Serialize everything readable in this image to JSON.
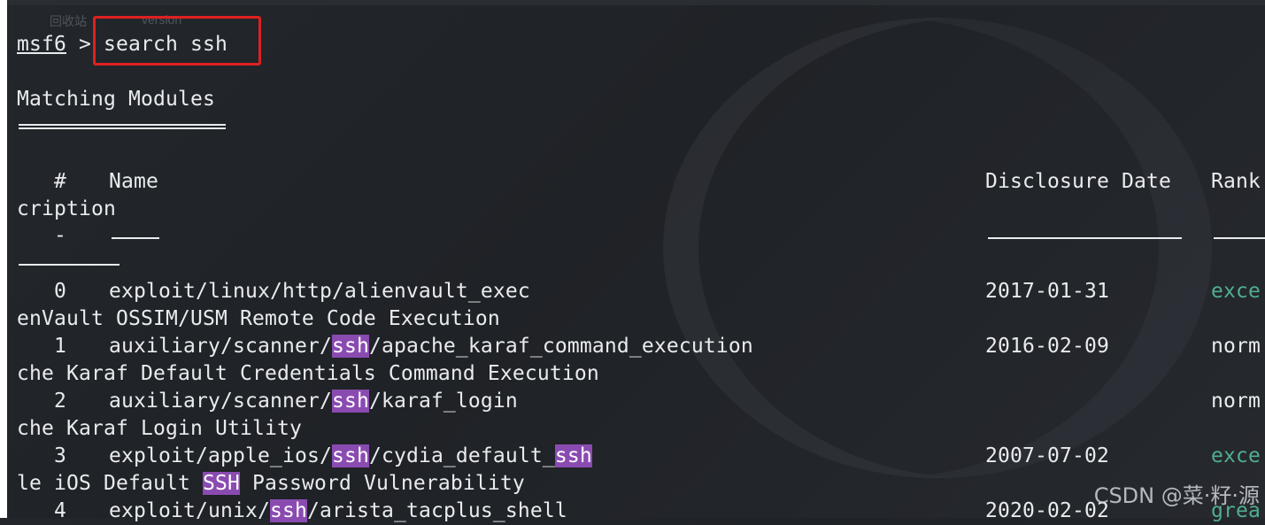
{
  "terminal": {
    "prompt": "msf6",
    "arrow": " > ",
    "command": "search ssh",
    "heading": "Matching Modules",
    "faded_top_left": "回收站",
    "faded_top_mid": "version"
  },
  "table": {
    "header_num": "   #   ",
    "header_name": "Name",
    "header_date": "Disclosure Date",
    "header_rank": "Rank",
    "header_desc_tail": "cription",
    "dash_num": "   -",
    "rows": [
      {
        "num": "   0   ",
        "name_parts": [
          {
            "t": "exploit/linux/http/alienvault_exec",
            "h": false
          }
        ],
        "date": "2017-01-31",
        "rank": "exce",
        "rank_green": true,
        "desc_parts": [
          {
            "t": "enVault OSSIM/USM Remote Code Execution",
            "h": false
          }
        ]
      },
      {
        "num": "   1   ",
        "name_parts": [
          {
            "t": "auxiliary/scanner/",
            "h": false
          },
          {
            "t": "ssh",
            "h": true
          },
          {
            "t": "/apache_karaf_command_execution",
            "h": false
          }
        ],
        "date": "2016-02-09",
        "rank": "norm",
        "rank_green": false,
        "desc_parts": [
          {
            "t": "che Karaf Default Credentials Command Execution",
            "h": false
          }
        ]
      },
      {
        "num": "   2   ",
        "name_parts": [
          {
            "t": "auxiliary/scanner/",
            "h": false
          },
          {
            "t": "ssh",
            "h": true
          },
          {
            "t": "/karaf_login",
            "h": false
          }
        ],
        "date": "",
        "rank": "norm",
        "rank_green": false,
        "desc_parts": [
          {
            "t": "che Karaf Login Utility",
            "h": false
          }
        ]
      },
      {
        "num": "   3   ",
        "name_parts": [
          {
            "t": "exploit/apple_ios/",
            "h": false
          },
          {
            "t": "ssh",
            "h": true
          },
          {
            "t": "/cydia_default_",
            "h": false
          },
          {
            "t": "ssh",
            "h": true
          }
        ],
        "date": "2007-07-02",
        "rank": "exce",
        "rank_green": true,
        "desc_parts": [
          {
            "t": "le iOS Default ",
            "h": false
          },
          {
            "t": "SSH",
            "h": true
          },
          {
            "t": " Password Vulnerability",
            "h": false
          }
        ]
      },
      {
        "num": "   4   ",
        "name_parts": [
          {
            "t": "exploit/unix/",
            "h": false
          },
          {
            "t": "ssh",
            "h": true
          },
          {
            "t": "/arista_tacplus_shell",
            "h": false
          }
        ],
        "date": "2020-02-02",
        "rank": "grea",
        "rank_green": true,
        "desc_parts": []
      }
    ]
  },
  "watermark": "CSDN @菜·籽·源",
  "colors": {
    "highlight": "#8a4bb1",
    "green_rank": "#4fae92",
    "annotation_box": "#e02020"
  }
}
